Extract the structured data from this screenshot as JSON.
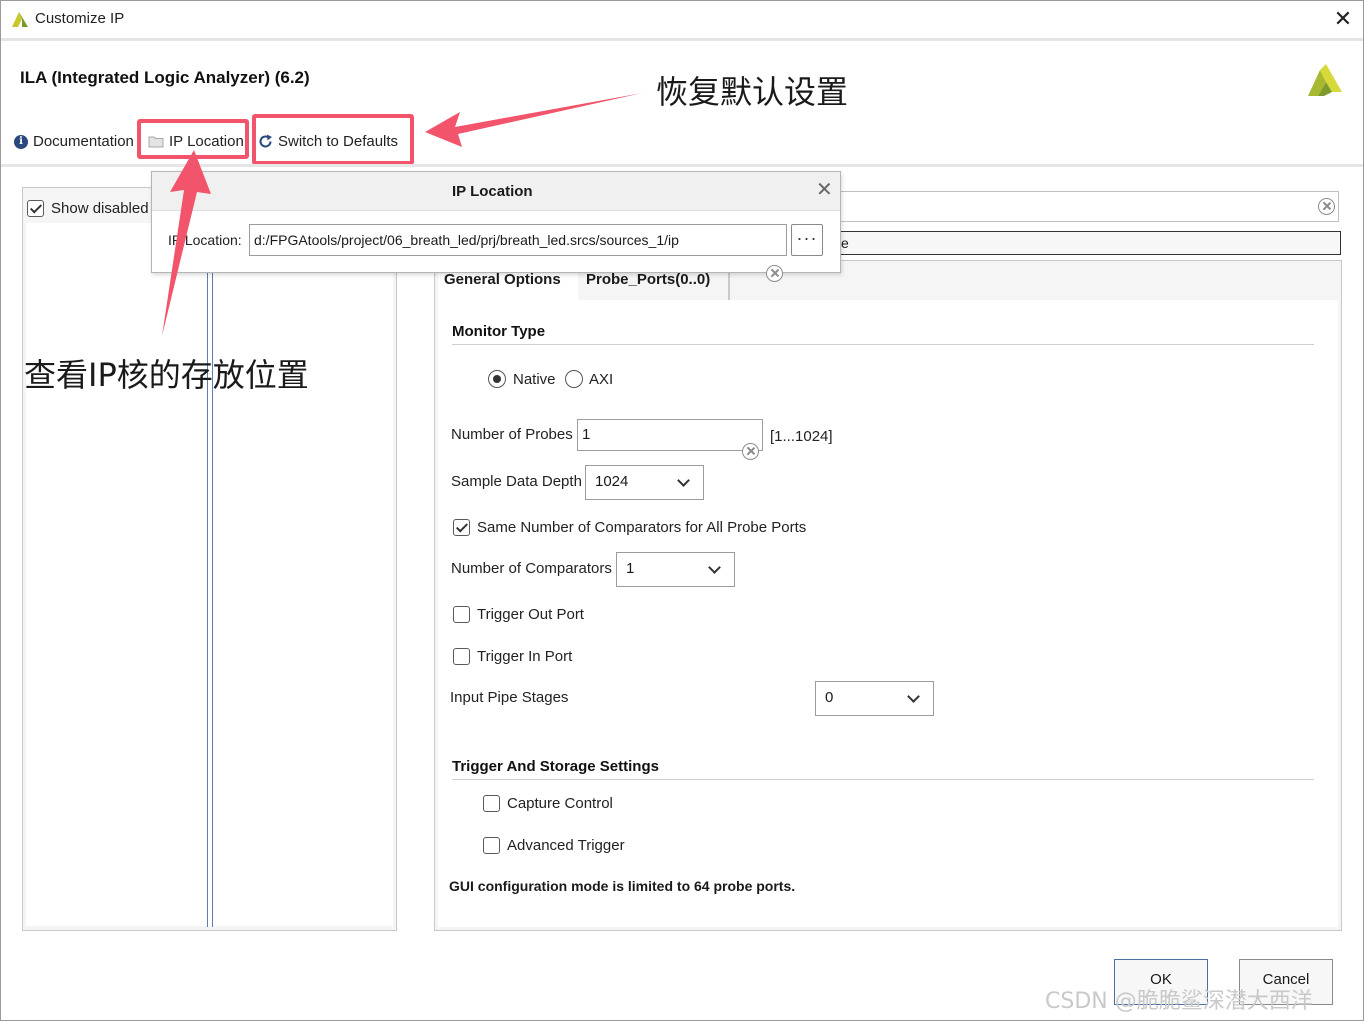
{
  "window": {
    "title": "Customize IP",
    "close_glyph": "✕"
  },
  "header": {
    "ip_title": "ILA (Integrated Logic Analyzer) (6.2)"
  },
  "toolbar": {
    "documentation_label": "Documentation",
    "ip_location_label": "IP Location",
    "switch_defaults_label": "Switch to Defaults"
  },
  "left_panel": {
    "show_disabled_label": "Show disabled"
  },
  "popup": {
    "title": "IP Location",
    "field_label": "IP Location:",
    "path_value": "d:/FPGAtools/project/06_breath_led/prj/breath_led.srcs/sources_1/ip",
    "browse_glyph": "···",
    "close_glyph": "✕",
    "behind_fragment": "e"
  },
  "tabs": [
    {
      "label": "General Options",
      "active": true
    },
    {
      "label": "Probe_Ports(0..0)",
      "active": false
    }
  ],
  "monitor_type": {
    "title": "Monitor Type",
    "options": [
      "Native",
      "AXI"
    ],
    "selected": "Native"
  },
  "number_of_probes": {
    "label": "Number of Probes",
    "value": "1",
    "range": "[1...1024]"
  },
  "sample_data_depth": {
    "label": "Sample Data Depth",
    "value": "1024"
  },
  "same_comparators": {
    "label": "Same Number of Comparators for All Probe Ports",
    "checked": true
  },
  "number_of_comparators": {
    "label": "Number of Comparators",
    "value": "1"
  },
  "trigger_out_port": {
    "label": "Trigger Out Port",
    "checked": false
  },
  "trigger_in_port": {
    "label": "Trigger In Port",
    "checked": false
  },
  "input_pipe_stages": {
    "label": "Input Pipe Stages",
    "value": "0"
  },
  "trigger_storage": {
    "title": "Trigger And Storage Settings",
    "capture_control": {
      "label": "Capture Control",
      "checked": false
    },
    "advanced_trigger": {
      "label": "Advanced Trigger",
      "checked": false
    }
  },
  "note": "GUI configuration mode is limited to 64 probe ports.",
  "buttons": {
    "ok_label": "OK",
    "cancel_label": "Cancel"
  },
  "annotations": {
    "defaults_note": "恢复默认设置",
    "location_note": "查看IP核的存放位置",
    "arrow_color": "#f2546c"
  },
  "watermark": "CSDN @脆脆鲨深潜大西洋",
  "colors": {
    "highlight_red": "#f2546c",
    "logo_yellow": "#c8c82a",
    "logo_green": "#7a9a2a"
  }
}
